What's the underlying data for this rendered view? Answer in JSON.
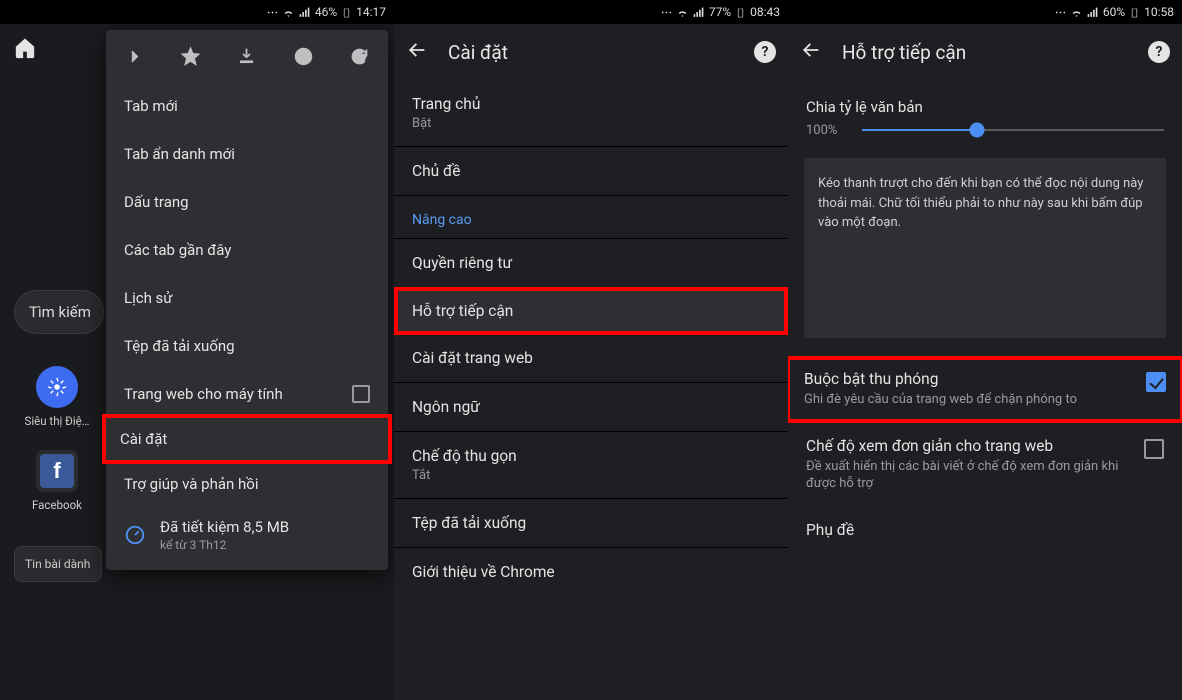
{
  "panel1": {
    "status": {
      "battery": "46%",
      "time": "14:17"
    },
    "search_chip": "Tìm kiếm",
    "shortcuts": [
      {
        "label": "Siêu thị Điệ…"
      },
      {
        "label": "Facebook"
      }
    ],
    "news_chip": "Tin bài dành",
    "menu": {
      "items": [
        "Tab mới",
        "Tab ẩn danh mới",
        "Dấu trang",
        "Các tab gần đây",
        "Lịch sử",
        "Tệp đã tải xuống",
        "Trang web cho máy tính",
        "Cài đặt",
        "Trợ giúp và phản hồi"
      ],
      "data_saved": {
        "line1": "Đã tiết kiệm 8,5 MB",
        "line2": "kể từ 3 Th12"
      }
    }
  },
  "panel2": {
    "status": {
      "battery": "77%",
      "time": "08:43"
    },
    "title": "Cài đặt",
    "items_top": [
      {
        "t1": "Trang chủ",
        "t2": "Bật"
      },
      {
        "t1": "Chủ đề"
      }
    ],
    "section": "Nâng cao",
    "items_adv": [
      {
        "t1": "Quyền riêng tư"
      },
      {
        "t1": "Hỗ trợ tiếp cận",
        "highlight": true
      },
      {
        "t1": "Cài đặt trang web"
      },
      {
        "t1": "Ngôn ngữ"
      },
      {
        "t1": "Chế độ thu gọn",
        "t2": "Tắt"
      },
      {
        "t1": "Tệp đã tải xuống"
      },
      {
        "t1": "Giới thiệu về Chrome"
      }
    ]
  },
  "panel3": {
    "status": {
      "battery": "60%",
      "time": "10:58"
    },
    "title": "Hỗ trợ tiếp cận",
    "scale": {
      "label": "Chia tỷ lệ văn bản",
      "value": "100%",
      "pct": 38
    },
    "sample": "Kéo thanh trượt cho đến khi bạn có thể đọc nội dung này thoải mái. Chữ tối thiểu phải to như này sau khi bấm đúp vào một đoạn.",
    "toggles": [
      {
        "t1": "Buộc bật thu phóng",
        "t2": "Ghi đè yêu cầu của trang web để chặn phóng to",
        "checked": true,
        "highlight": true
      },
      {
        "t1": "Chế độ xem đơn giản cho trang web",
        "t2": "Đề xuất hiển thị các bài viết ở chế độ xem đơn giản khi được hỗ trợ",
        "checked": false
      },
      {
        "t1": "Phụ đề"
      }
    ]
  }
}
